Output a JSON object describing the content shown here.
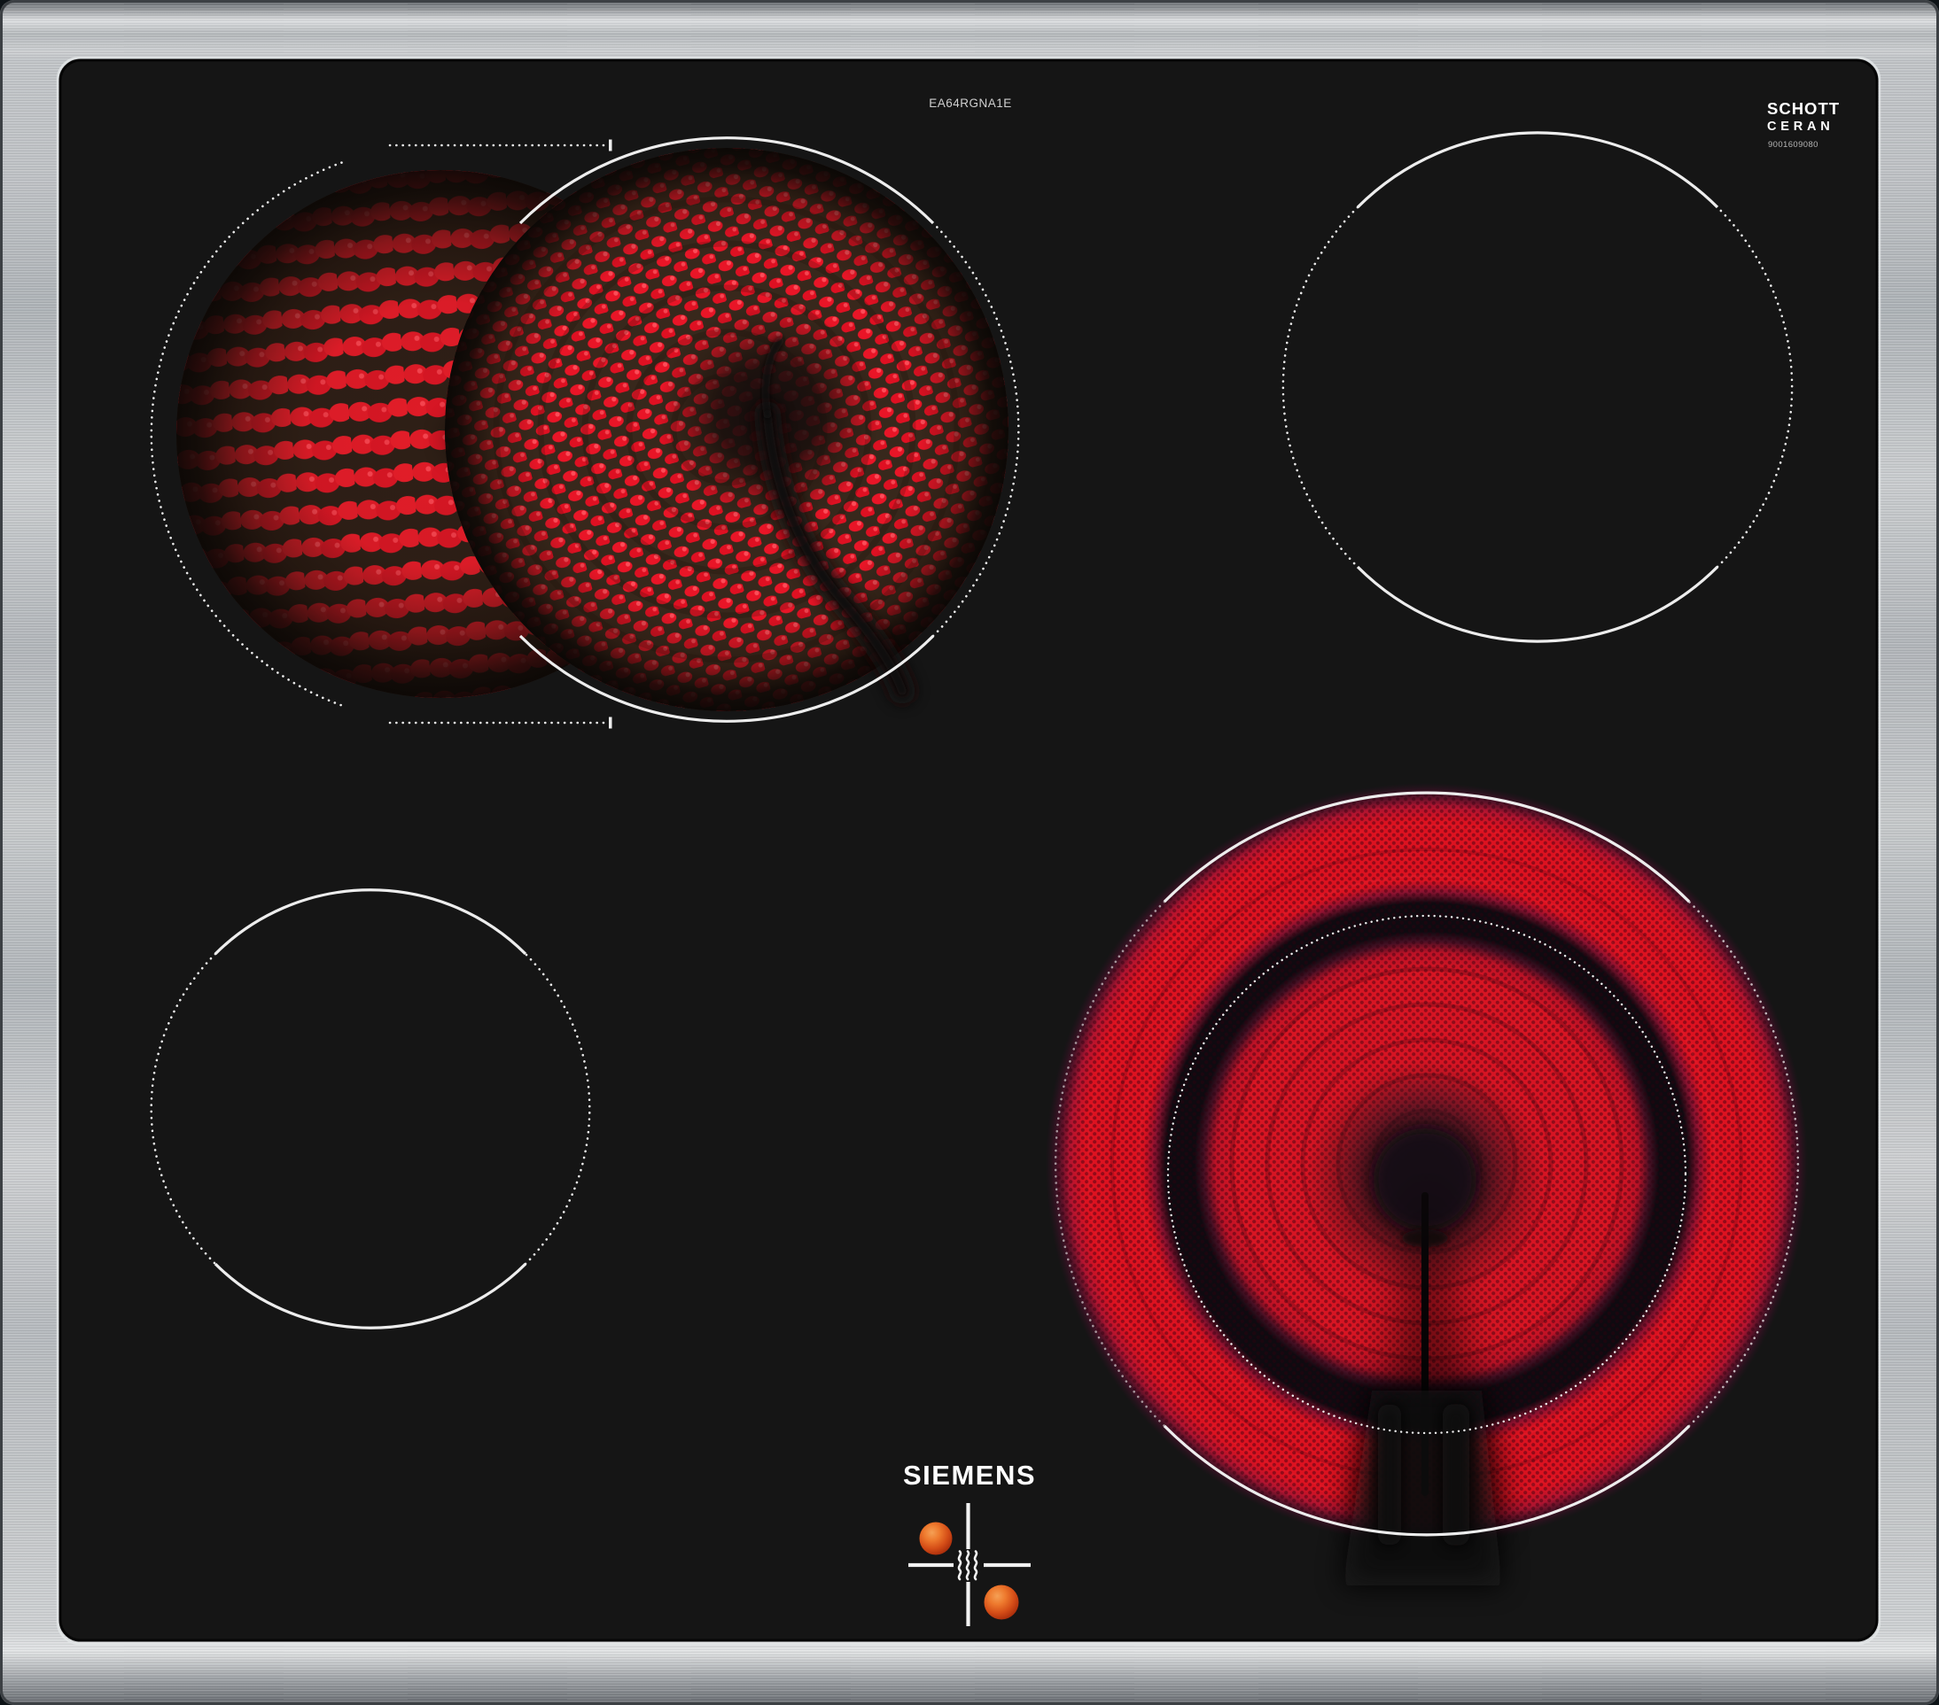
{
  "header": {
    "model_label": "EA64RGNA1E"
  },
  "branding": {
    "manufacturer_logo": "SIEMENS",
    "glass_logo_line1": "SCHOTT",
    "glass_logo_line2": "CERAN",
    "glass_part_number": "9001609080"
  },
  "colors": {
    "steel_frame": "#b7bbbf",
    "glass": "#151515",
    "zone_outline": "#ededed",
    "element_glow_red": "#d81523",
    "hot_surface_dot": "#e86f28"
  },
  "icons": {
    "residual_heat": "heat-waves",
    "hot_surface_dot_count": 2
  },
  "zones": [
    {
      "name": "back-left",
      "state": "on",
      "type": "dual-circuit-extended"
    },
    {
      "name": "back-right",
      "state": "off",
      "type": "single-circuit"
    },
    {
      "name": "front-left",
      "state": "off",
      "type": "single-circuit"
    },
    {
      "name": "front-right",
      "state": "on",
      "type": "dual-circuit"
    }
  ]
}
